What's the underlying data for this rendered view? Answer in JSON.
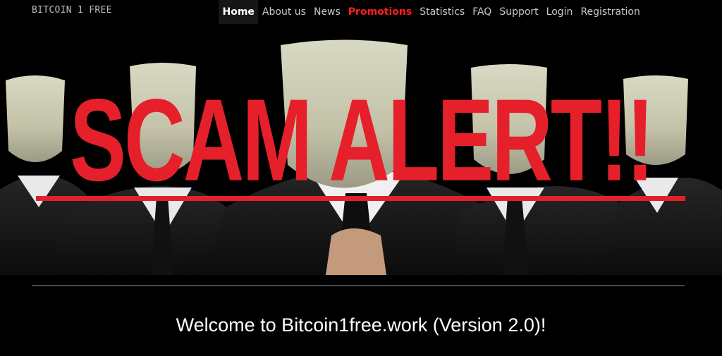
{
  "navbar": {
    "brand": "BITCOIN 1 FREE",
    "items": [
      {
        "label": "Home"
      },
      {
        "label": "About us"
      },
      {
        "label": "News"
      },
      {
        "label": "Promotions"
      },
      {
        "label": "Statistics"
      },
      {
        "label": "FAQ"
      },
      {
        "label": "Support"
      },
      {
        "label": "Login"
      },
      {
        "label": "Registration"
      }
    ],
    "active_item": "Home",
    "highlight_item": "Promotions"
  },
  "hero": {
    "overlay_text": "SCAM ALERT!!",
    "image": "masked-figures-in-suits",
    "colors": {
      "overlay": "#e5202a"
    }
  },
  "welcome": {
    "text": "Welcome to Bitcoin1free.work (Version 2.0)!"
  },
  "colors": {
    "background": "#000000",
    "promo_link": "#ff1f1f",
    "nav_text": "#c8c8c8"
  }
}
